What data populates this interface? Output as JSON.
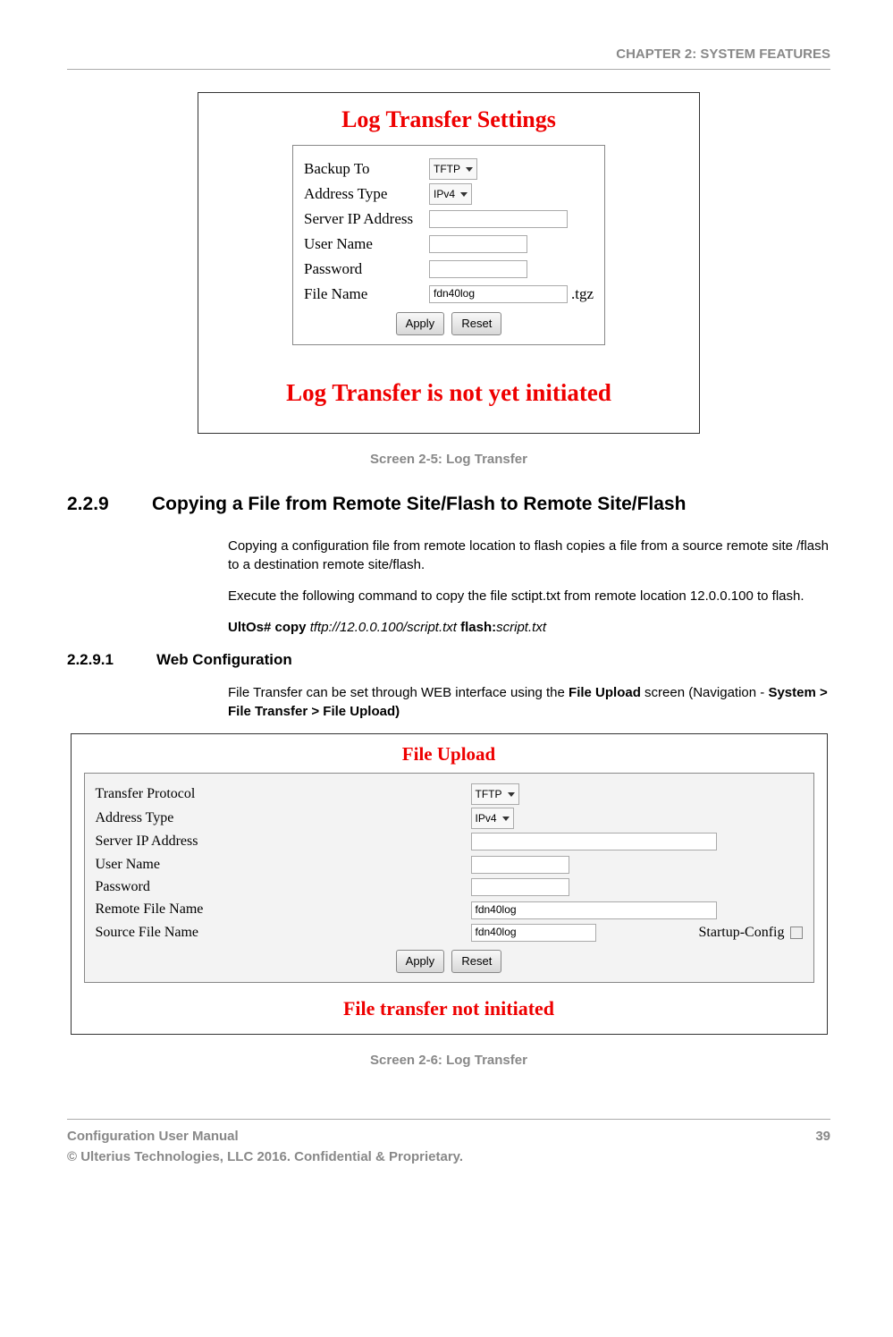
{
  "chapter_header": "CHAPTER 2: SYSTEM FEATURES",
  "screenshot1": {
    "title": "Log Transfer Settings",
    "fields": {
      "backup_to_label": "Backup To",
      "backup_to_value": "TFTP",
      "address_type_label": "Address Type",
      "address_type_value": "IPv4",
      "server_ip_label": "Server IP Address",
      "server_ip_value": "",
      "username_label": "User Name",
      "username_value": "",
      "password_label": "Password",
      "password_value": "",
      "filename_label": "File Name",
      "filename_value": "fdn40log",
      "filename_ext": ".tgz"
    },
    "apply": "Apply",
    "reset": "Reset",
    "status": "Log Transfer is not yet initiated"
  },
  "caption1": "Screen 2-5: Log Transfer",
  "section_229": {
    "num": "2.2.9",
    "title": "Copying a File from Remote Site/Flash to Remote Site/Flash",
    "p1": "Copying a configuration file from remote location to flash copies a file from a source remote site /flash to a destination remote site/flash.",
    "p2": "Execute the following command to copy the file sctipt.txt from remote location 12.0.0.100 to flash.",
    "cmd_prefix": "UltOs# copy ",
    "cmd_url": "tftp://12.0.0.100/script.txt ",
    "cmd_flash": "flash:",
    "cmd_file": "script.txt"
  },
  "section_2291": {
    "num": "2.2.9.1",
    "title": "Web Configuration",
    "p1a": "File Transfer can be set through WEB interface using the ",
    "p1b": "File Upload",
    "p1c": " screen (Navigation - ",
    "p1d": "System > File Transfer > File Upload)"
  },
  "screenshot2": {
    "title": "File Upload",
    "fields": {
      "protocol_label": "Transfer Protocol",
      "protocol_value": "TFTP",
      "address_type_label": "Address Type",
      "address_type_value": "IPv4",
      "server_ip_label": "Server IP Address",
      "server_ip_value": "",
      "username_label": "User Name",
      "username_value": "",
      "password_label": "Password",
      "password_value": "",
      "remote_file_label": "Remote File Name",
      "remote_file_value": "fdn40log",
      "source_file_label": "Source File Name",
      "source_file_value": "fdn40log",
      "startup_config_label": "Startup-Config"
    },
    "apply": "Apply",
    "reset": "Reset",
    "status": "File transfer not initiated"
  },
  "caption2": "Screen 2-6: Log Transfer",
  "footer": {
    "line1": "Configuration User Manual",
    "line2": "© Ulterius Technologies, LLC 2016. Confidential & Proprietary.",
    "page": "39"
  }
}
